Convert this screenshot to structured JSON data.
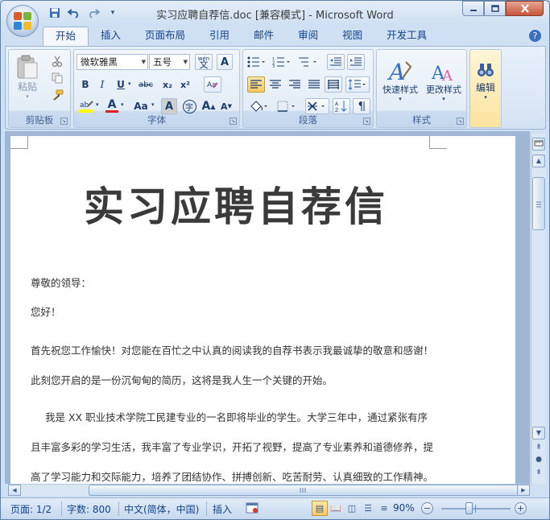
{
  "window": {
    "title": "实习应聘自荐信.doc [兼容模式] - Microsoft Word",
    "min_icon": "minimize-icon",
    "max_icon": "maximize-icon",
    "close_icon": "close-icon"
  },
  "qat": {
    "save_icon": "save-icon",
    "undo_icon": "undo-icon",
    "redo_icon": "redo-icon",
    "customize_icon": "dropdown-icon"
  },
  "tabs": [
    {
      "label": "开始",
      "active": true
    },
    {
      "label": "插入"
    },
    {
      "label": "页面布局"
    },
    {
      "label": "引用"
    },
    {
      "label": "邮件"
    },
    {
      "label": "审阅"
    },
    {
      "label": "视图"
    },
    {
      "label": "开发工具"
    }
  ],
  "ribbon": {
    "clipboard": {
      "label": "剪贴板",
      "paste": "粘贴"
    },
    "font": {
      "label": "字体",
      "font_name": "微软雅黑",
      "font_size": "五号",
      "wen": "wén",
      "wen2": "文",
      "bold": "B",
      "italic": "I",
      "underline": "U",
      "strike": "abc",
      "sub": "x₂",
      "sup": "x²",
      "aa": "Aa",
      "font_color": "A",
      "char_border": "A",
      "grow": "A",
      "shrink": "A",
      "enclose": "字"
    },
    "paragraph": {
      "label": "段落"
    },
    "styles": {
      "label": "样式",
      "quick_styles": "快速样式",
      "change_styles": "更改样式"
    },
    "editing": {
      "label": "编辑"
    }
  },
  "document": {
    "title": "实习应聘自荐信",
    "paragraphs": [
      "尊敬的领导：",
      "您好！",
      "首先祝您工作愉快！对您能在百忙之中认真的阅读我的自荐书表示我最诚挚的敬意和感谢！",
      "此刻您开启的是一份沉甸甸的简历，这将是我人生一个关键的开始。",
      "我是 XX 职业技术学院工民建专业的一名即将毕业的学生。大学三年中，通过紧张有序",
      "且丰富多彩的学习生活，我丰富了专业学识，开拓了视野，提高了专业素养和道德修养，提",
      "高了学习能力和交际能力，培养了团结协作、拼搏创新、吃苦耐劳、认真细致的工作精神。"
    ]
  },
  "statusbar": {
    "page": "页面: 1/2",
    "words": "字数: 800",
    "language": "中文(简体，中国)",
    "mode": "插入",
    "zoom": "90%",
    "zoom_minus": "−",
    "zoom_plus": "+"
  },
  "colors": {
    "accent": "#15428b",
    "highlight_yellow": "#ffff00",
    "font_red": "#e02020"
  }
}
